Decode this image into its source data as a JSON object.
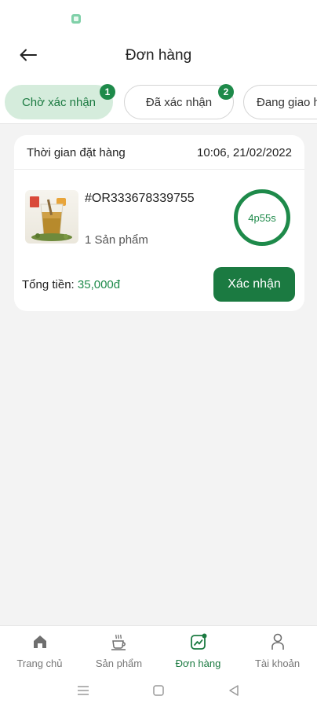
{
  "header": {
    "title": "Đơn hàng"
  },
  "tabs": [
    {
      "label": "Chờ xác nhận",
      "badge": "1",
      "active": true
    },
    {
      "label": "Đã xác nhận",
      "badge": "2",
      "active": false
    },
    {
      "label": "Đang giao h",
      "active": false
    }
  ],
  "order": {
    "time_label": "Thời gian đặt hàng",
    "time_value": "10:06, 21/02/2022",
    "id": "#OR333678339755",
    "product_count": "1 Sản phẩm",
    "timer": "4p55s",
    "total_label": "Tổng tiền: ",
    "total_value": "35,000đ",
    "confirm_label": "Xác nhận"
  },
  "nav": [
    {
      "label": "Trang chủ",
      "icon": "home-icon"
    },
    {
      "label": "Sản phẩm",
      "icon": "coffee-cup-icon"
    },
    {
      "label": "Đơn hàng",
      "icon": "orders-chart-icon",
      "active": true
    },
    {
      "label": "Tài khoản",
      "icon": "user-icon"
    }
  ],
  "colors": {
    "primary": "#1b7a41",
    "accent": "#1e8a4a",
    "active_tab_bg": "#d5ecdc"
  }
}
